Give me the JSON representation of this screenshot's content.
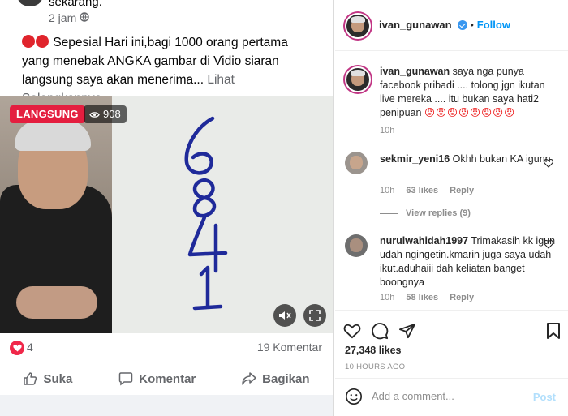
{
  "facebook_post": {
    "truncated_text": "sekarang.",
    "time": "2 jam",
    "post_text": "Sepesial Hari ini,bagi 1000 orang pertama yang menebak ANGKA gambar di Vidio siaran langsung saya akan menerima...",
    "see_more": "Lihat Selengkapnya",
    "live_badge": "LANGSUNG",
    "viewer_count": "908",
    "reaction_count": "4",
    "comment_count": "19 Komentar",
    "actions": {
      "like": "Suka",
      "comment": "Komentar",
      "share": "Bagikan"
    },
    "colors": {
      "live": "#e41e3f",
      "reaction": "#f0284a"
    }
  },
  "instagram": {
    "header": {
      "username": "ivan_gunawan",
      "follow_separator": "•",
      "follow_label": "Follow"
    },
    "caption": {
      "username": "ivan_gunawan",
      "text": "saya nga punya facebook pribadi .... tolong jgn ikutan live mereka .... itu bukan saya hati2 penipuan",
      "emojis": "😡😡😡😡😡😡😡😡",
      "time": "10h"
    },
    "comments": [
      {
        "username": "sekmir_yeni16",
        "text": "Okhh bukan KA igunn",
        "time": "10h",
        "likes": "63 likes",
        "reply": "Reply",
        "view_replies": "View replies (9)"
      },
      {
        "username": "nurulwahidah1997",
        "text": "Trimakasih kk igun udah ngingetin.kmarin juga saya udah ikut.aduhaiii dah keliatan banget boongnya",
        "time": "10h",
        "likes": "58 likes",
        "reply": "Reply"
      }
    ],
    "likes_count": "27,348 likes",
    "time_ago": "10 HOURS AGO",
    "add_comment_placeholder": "Add a comment...",
    "post_label": "Post",
    "colors": {
      "link": "#0095f6",
      "verified": "#3897f0",
      "post_disabled": "#b2dffc"
    }
  }
}
